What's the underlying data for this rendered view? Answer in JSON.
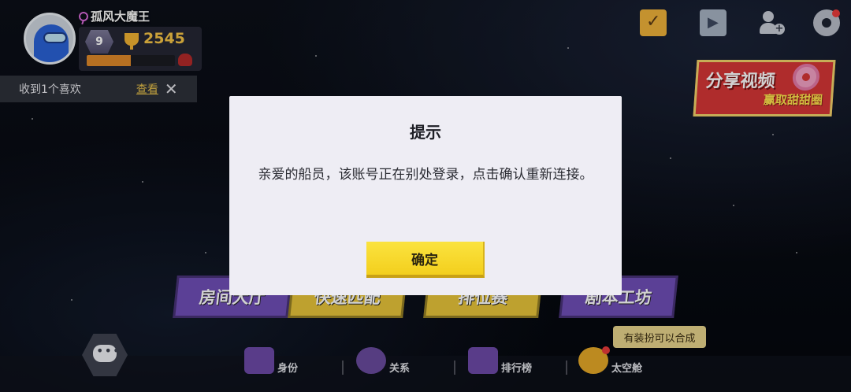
{
  "profile": {
    "username": "孤风大魔王",
    "level": "9",
    "trophies": "2545",
    "xp_fraction": 0.5
  },
  "like_banner": {
    "text": "收到1个喜欢",
    "view_label": "查看",
    "close_label": "✕"
  },
  "top_icons": [
    "calendar-check-icon",
    "tv-play-icon",
    "add-friend-icon",
    "gear-icon"
  ],
  "share_banner": {
    "main": "分享视频",
    "sub": "赢取甜甜圈"
  },
  "modes": [
    {
      "label": "房间大厅"
    },
    {
      "label": "快速匹配"
    },
    {
      "label": "排位赛"
    },
    {
      "label": "剧本工坊"
    }
  ],
  "bottom_nav": [
    {
      "label": "身份"
    },
    {
      "label": "关系"
    },
    {
      "label": "排行榜"
    },
    {
      "label": "太空舱"
    }
  ],
  "tooltip": "有装扮可以合成",
  "dialog": {
    "title": "提示",
    "message": "亲爱的船员，该账号正在别处登录，点击确认重新连接。",
    "confirm_label": "确定"
  },
  "colors": {
    "accent_yellow": "#f3cf1d",
    "mode_purple": "#6f4fb8",
    "trophy_gold": "#f7c546",
    "share_red": "#d63636"
  }
}
